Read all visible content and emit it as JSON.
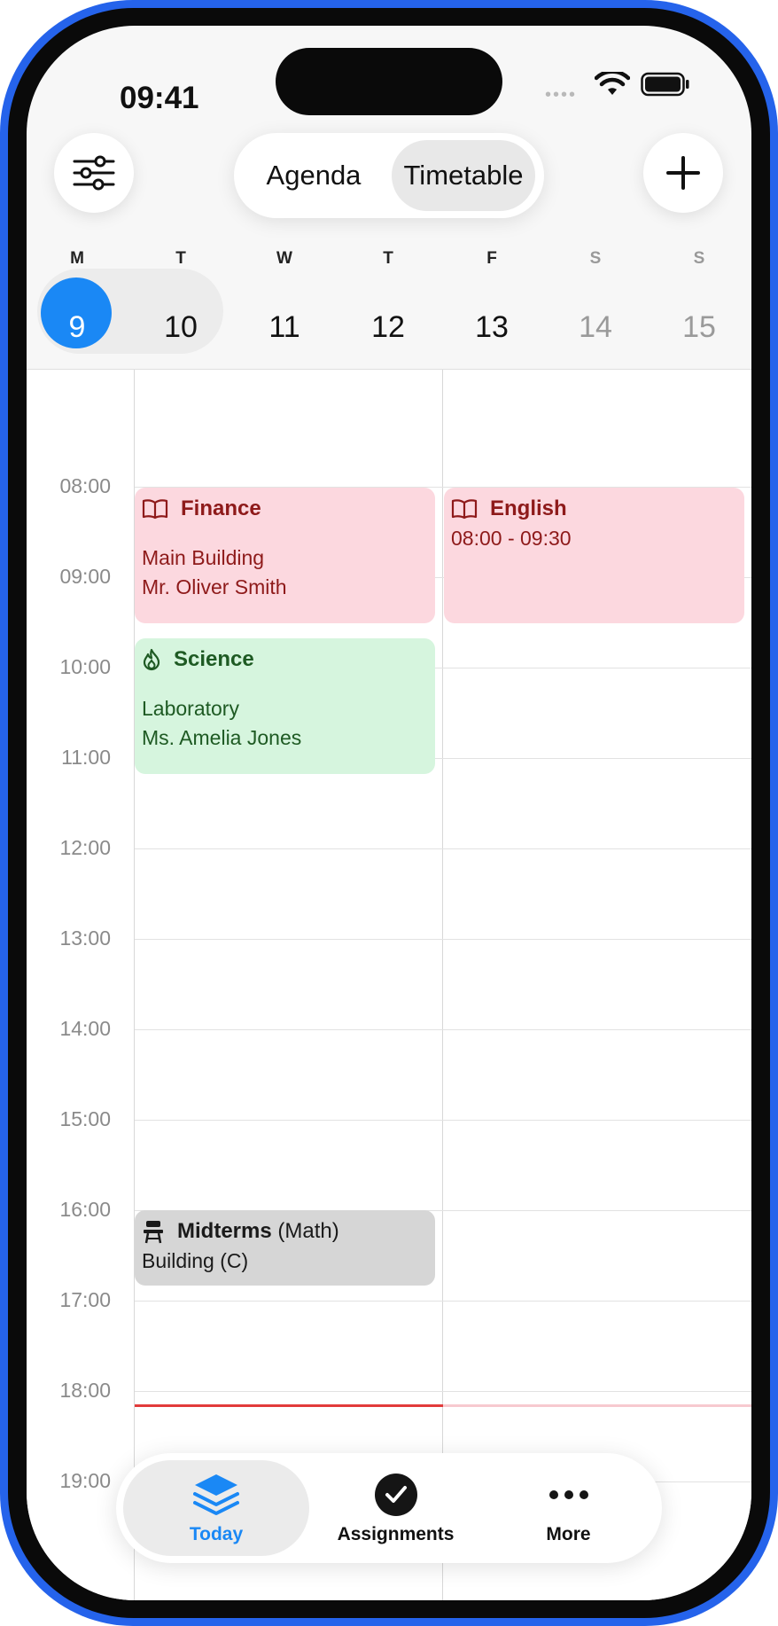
{
  "status": {
    "time": "09:41",
    "signal": "••••"
  },
  "header": {
    "filter_icon": "sliders-icon",
    "segments": [
      {
        "label": "Agenda"
      },
      {
        "label": "Timetable"
      }
    ],
    "selected_segment": "Timetable",
    "add_icon": "plus-icon"
  },
  "week": {
    "days": [
      {
        "letter": "M",
        "num": "9"
      },
      {
        "letter": "T",
        "num": "10"
      },
      {
        "letter": "W",
        "num": "11"
      },
      {
        "letter": "T",
        "num": "12"
      },
      {
        "letter": "F",
        "num": "13"
      },
      {
        "letter": "S",
        "num": "14"
      },
      {
        "letter": "S",
        "num": "15"
      }
    ],
    "selected": "9"
  },
  "timeline": {
    "hours": [
      "08:00",
      "09:00",
      "10:00",
      "11:00",
      "12:00",
      "13:00",
      "14:00",
      "15:00",
      "16:00",
      "17:00",
      "18:00",
      "19:00"
    ]
  },
  "events": {
    "finance": {
      "title": "Finance",
      "icon": "book-icon",
      "location": "Main Building",
      "teacher": "Mr. Oliver Smith",
      "color": "#fcd8df"
    },
    "english": {
      "title": "English",
      "icon": "book-icon",
      "time": "08:00 - 09:30",
      "color": "#fcd8df"
    },
    "science": {
      "title": "Science",
      "icon": "flame-icon",
      "location": "Laboratory",
      "teacher": "Ms. Amelia Jones",
      "color": "#d6f5de"
    },
    "midterms": {
      "title": "Midterms",
      "subject": "(Math)",
      "icon": "desk-icon",
      "location": "Building (C)",
      "color": "#d6d6d6"
    }
  },
  "now_indicator_color": "#e23b3b",
  "tabbar": {
    "tabs": [
      {
        "label": "Today",
        "icon": "stack-icon",
        "active": true
      },
      {
        "label": "Assignments",
        "icon": "checkmark-circle-icon",
        "active": false
      },
      {
        "label": "More",
        "icon": "ellipsis-icon",
        "active": false
      }
    ]
  },
  "colors": {
    "accent": "#1a88f5",
    "frame": "#2563eb"
  }
}
